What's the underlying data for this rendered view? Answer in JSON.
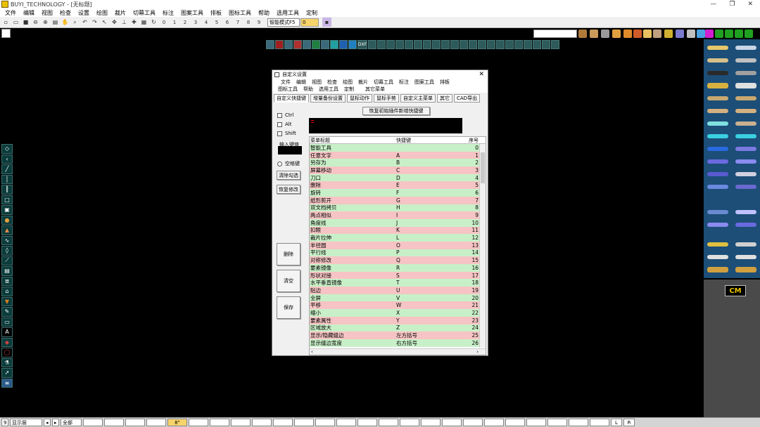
{
  "window": {
    "title": "BUYI_TECHNOLOGY - [无标题]",
    "min": "—",
    "max": "❐",
    "close": "✕"
  },
  "menu": [
    "文件",
    "编辑",
    "视图",
    "检查",
    "设置",
    "绘图",
    "裁片",
    "切幕工具",
    "标注",
    "图案工具",
    "排板",
    "图标工具",
    "帮助",
    "选用工具",
    "定制"
  ],
  "toolbar": {
    "numbers": [
      "0",
      "1",
      "2",
      "3",
      "4",
      "5",
      "6",
      "7",
      "8",
      "9"
    ],
    "mode_select": "智能模式F5",
    "value_field": "0"
  },
  "strip_label": "DXF",
  "dialog": {
    "title": "自定义设置",
    "close": "✕",
    "menu_row1": [
      "文件",
      "编辑",
      "视图",
      "检查",
      "绘图",
      "裁片",
      "切幕工具",
      "标注",
      "图案工具",
      "排板"
    ],
    "menu_row2": [
      "图标工具",
      "帮助",
      "选用工具",
      "定制",
      "",
      "其它菜单"
    ],
    "tabs": [
      "自定义快捷键",
      "增量备份设置",
      "鼠标动作",
      "鼠标手势",
      "自定义主菜单",
      "其它",
      "CAD导出"
    ],
    "restore_button": "恢复初始插件新增快捷键",
    "mod_ctrl": "Ctrl",
    "mod_alt": "Alt",
    "mod_shift": "Shift",
    "key_input_label": "输入键值",
    "space_key": "空格键",
    "clear_check_button": "清除勾选",
    "restore_modify_button": "恢复修改",
    "delete_button": "删除",
    "clear_button": "清空",
    "save_button": "保存",
    "columns": [
      "菜单标题",
      "快捷键",
      "序号"
    ],
    "rows": [
      [
        "智能工具",
        "",
        "0"
      ],
      [
        "任意文字",
        "A",
        "1"
      ],
      [
        "另存为",
        "B",
        "2"
      ],
      [
        "屏幕移动",
        "C",
        "3"
      ],
      [
        "刀口",
        "D",
        "4"
      ],
      [
        "删除",
        "E",
        "5"
      ],
      [
        "旋转",
        "F",
        "6"
      ],
      [
        "纸形剪开",
        "G",
        "7"
      ],
      [
        "双文档拷贝",
        "H",
        "8"
      ],
      [
        "两点相似",
        "I",
        "9"
      ],
      [
        "角度线",
        "J",
        "10"
      ],
      [
        "扣眼",
        "K",
        "11"
      ],
      [
        "裁片拉伸",
        "L",
        "12"
      ],
      [
        "半径圆",
        "O",
        "13"
      ],
      [
        "平行线",
        "P",
        "14"
      ],
      [
        "对称修改",
        "Q",
        "15"
      ],
      [
        "要素镜像",
        "R",
        "16"
      ],
      [
        "形状对接",
        "S",
        "17"
      ],
      [
        "水平垂直镜像",
        "T",
        "18"
      ],
      [
        "贴边",
        "U",
        "19"
      ],
      [
        "全屏",
        "V",
        "20"
      ],
      [
        "平移",
        "W",
        "21"
      ],
      [
        "缩小",
        "X",
        "22"
      ],
      [
        "要素属性",
        "Y",
        "23"
      ],
      [
        "区域放大",
        "Z",
        "24"
      ],
      [
        "显示/隐藏缝边",
        "左方括号",
        "25"
      ],
      [
        "显示缝边宽度",
        "右方括号",
        "26"
      ]
    ],
    "scroll_left": "‹",
    "scroll_right": "›"
  },
  "right_panel": {
    "badge": "CM"
  },
  "status": {
    "field1": "显示层",
    "field2": "全部",
    "field3": "9",
    "field4": "8\"",
    "left_btn": "L",
    "right_btn": "R"
  },
  "colors": {
    "accent_green": "#c8f0c8",
    "accent_pink": "#f6c4c4",
    "panel_blue": "#1c4e78"
  }
}
